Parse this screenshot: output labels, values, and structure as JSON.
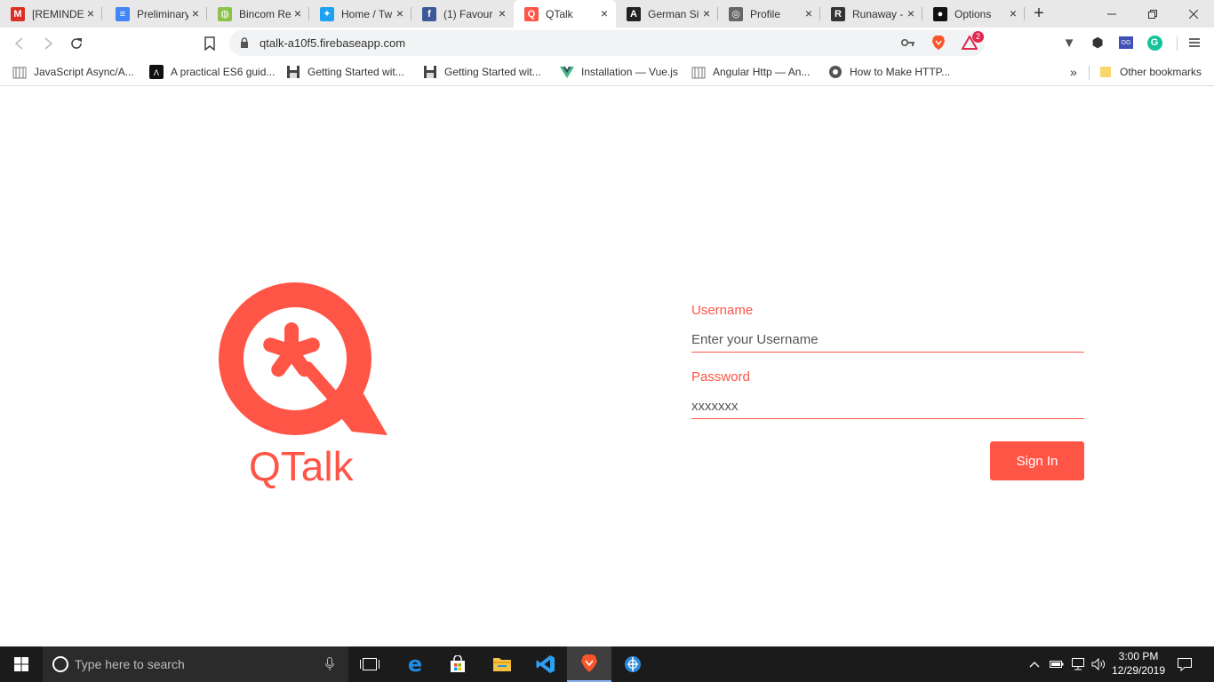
{
  "browser": {
    "tabs": [
      {
        "title": "[REMINDER",
        "icon": "gmail-icon",
        "color": "#d93025",
        "glyph": "M"
      },
      {
        "title": "Preliminary",
        "icon": "docs-icon",
        "color": "#4285f4",
        "glyph": "≡"
      },
      {
        "title": "Bincom Re",
        "icon": "bincom-icon",
        "color": "#8bc34a",
        "glyph": "◍"
      },
      {
        "title": "Home / Tw",
        "icon": "twitter-icon",
        "color": "#1da1f2",
        "glyph": "✦"
      },
      {
        "title": "(1) Favour",
        "icon": "facebook-icon",
        "color": "#3b5998",
        "glyph": "f"
      },
      {
        "title": "QTalk",
        "icon": "qtalk-icon",
        "color": "#ff5547",
        "glyph": "Q"
      },
      {
        "title": "German Sit",
        "icon": "angular-icon",
        "color": "#222222",
        "glyph": "A"
      },
      {
        "title": "Profile",
        "icon": "globe-icon",
        "color": "#666666",
        "glyph": "◎"
      },
      {
        "title": "Runaway -",
        "icon": "runaway-icon",
        "color": "#333333",
        "glyph": "R"
      },
      {
        "title": "Options",
        "icon": "github-icon",
        "color": "#111111",
        "glyph": "●"
      }
    ],
    "url": "qtalk-a10f5.firebaseapp.com",
    "brave_badge": "2",
    "extensions": [
      {
        "name": "extension-v-icon",
        "glyph": "▼",
        "color": "#555555"
      },
      {
        "name": "extension-cube-icon",
        "glyph": "⬢",
        "color": "#333333"
      },
      {
        "name": "extension-og-icon",
        "glyph": "OG",
        "color": "#3f51b5"
      },
      {
        "name": "grammarly-icon",
        "glyph": "G",
        "color": "#15c39a"
      }
    ]
  },
  "bookmarks": {
    "items": [
      {
        "label": "JavaScript Async/A...",
        "icon": "bookmark-site-icon"
      },
      {
        "label": "A practical ES6 guid...",
        "icon": "bookmark-dev-icon"
      },
      {
        "label": "Getting Started wit...",
        "icon": "floppy-icon"
      },
      {
        "label": "Getting Started wit...",
        "icon": "floppy-icon"
      },
      {
        "label": "Installation — Vue.js",
        "icon": "vue-icon"
      },
      {
        "label": "Angular Http — An...",
        "icon": "bookmark-site-icon"
      },
      {
        "label": "How to Make HTTP...",
        "icon": "globe-icon"
      }
    ],
    "overflow": "»",
    "other": "Other bookmarks"
  },
  "login": {
    "brand_name": "QTalk",
    "username_label": "Username",
    "username_placeholder": "Enter your Username",
    "password_label": "Password",
    "password_placeholder": "xxxxxxx",
    "submit_label": "Sign In",
    "accent_color": "#ff5547"
  },
  "taskbar": {
    "search_placeholder": "Type here to search",
    "time": "3:00 PM",
    "date": "12/29/2019"
  }
}
